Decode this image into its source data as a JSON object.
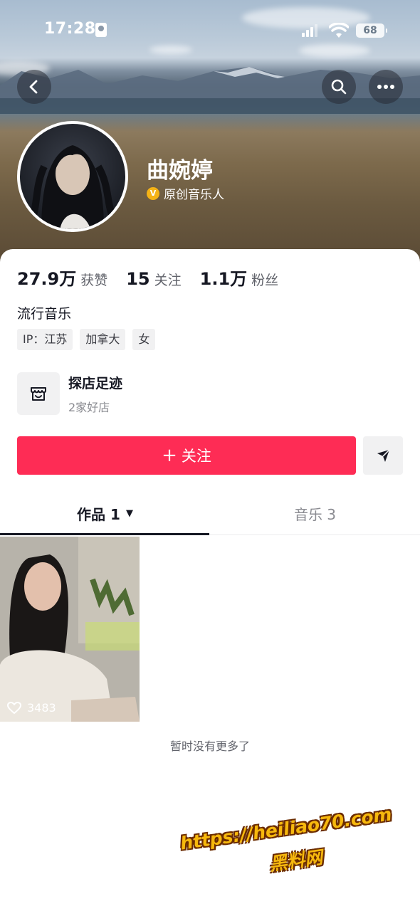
{
  "status_bar": {
    "time": "17:28",
    "battery": "68"
  },
  "profile": {
    "name": "曲婉婷",
    "verified_label": "原创音乐人",
    "bio": "流行音乐",
    "tags": [
      "IP：江苏",
      "加拿大",
      "女"
    ]
  },
  "stats": [
    {
      "value": "27.9万",
      "label": "获赞"
    },
    {
      "value": "15",
      "label": "关注"
    },
    {
      "value": "1.1万",
      "label": "粉丝"
    }
  ],
  "shop": {
    "title": "探店足迹",
    "subtitle": "2家好店"
  },
  "actions": {
    "follow_label": "关注",
    "follow_plus": "+"
  },
  "tabs": [
    {
      "label": "作品 1",
      "active": true
    },
    {
      "label": "音乐 3",
      "active": false
    }
  ],
  "videos": [
    {
      "likes": "3483"
    }
  ],
  "footer_note": "暂时没有更多了",
  "watermark": {
    "url": "https://heiliao70.com",
    "site": "黑料网"
  },
  "colors": {
    "accent": "#fe2c55",
    "verified": "#f5b316",
    "watermark": "#f6b80d"
  },
  "icons": [
    "back-icon",
    "search-icon",
    "more-icon",
    "store-icon",
    "share-icon",
    "heart-icon"
  ]
}
